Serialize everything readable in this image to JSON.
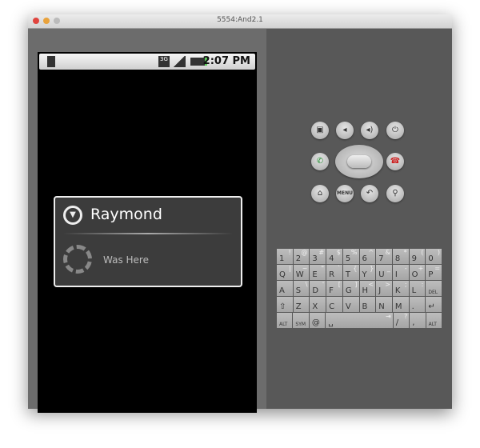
{
  "window": {
    "title": "5554:And2.1"
  },
  "status_bar": {
    "time": "2:07 PM",
    "icons": [
      "sd-card-alert-icon",
      "3g-icon",
      "signal-icon",
      "battery-charging-icon"
    ]
  },
  "dialog": {
    "title": "Raymond",
    "message": "Was Here",
    "icon": "dropdown-circle-icon"
  },
  "controls": {
    "menu_label": "MENU"
  },
  "keyboard": {
    "rows": [
      [
        [
          "1",
          "!"
        ],
        [
          "2",
          "@"
        ],
        [
          "3",
          "#"
        ],
        [
          "4",
          "$"
        ],
        [
          "5",
          "%"
        ],
        [
          "6",
          "^"
        ],
        [
          "7",
          "&"
        ],
        [
          "8",
          "*"
        ],
        [
          "9",
          "("
        ],
        [
          "0",
          ")"
        ]
      ],
      [
        [
          "Q",
          "|"
        ],
        [
          "W",
          "~"
        ],
        [
          "E",
          "\""
        ],
        [
          "R",
          "`"
        ],
        [
          "T",
          "{"
        ],
        [
          "Y",
          "}"
        ],
        [
          "U",
          "_"
        ],
        [
          "I",
          "-"
        ],
        [
          "O",
          "+"
        ],
        [
          "P",
          "="
        ]
      ],
      [
        [
          "A",
          ""
        ],
        [
          "S",
          "\\"
        ],
        [
          "D",
          "'"
        ],
        [
          "F",
          "["
        ],
        [
          "G",
          "]"
        ],
        [
          "H",
          "<"
        ],
        [
          "J",
          ">"
        ],
        [
          "K",
          ";"
        ],
        [
          "L",
          ":"
        ],
        [
          "DEL",
          ""
        ]
      ],
      [
        [
          "⇧",
          ""
        ],
        [
          "Z",
          ""
        ],
        [
          "X",
          ""
        ],
        [
          "C",
          ""
        ],
        [
          "V",
          ""
        ],
        [
          "B",
          ""
        ],
        [
          "N",
          ""
        ],
        [
          "M",
          ""
        ],
        [
          ".",
          ""
        ],
        [
          "↵",
          ""
        ]
      ],
      [
        [
          "ALT",
          ""
        ],
        [
          "SYM",
          ""
        ],
        [
          "@",
          ""
        ],
        [
          "␣",
          "⇥"
        ],
        [
          "/",
          "?"
        ],
        [
          ",",
          ""
        ],
        [
          "ALT",
          ""
        ]
      ]
    ]
  }
}
